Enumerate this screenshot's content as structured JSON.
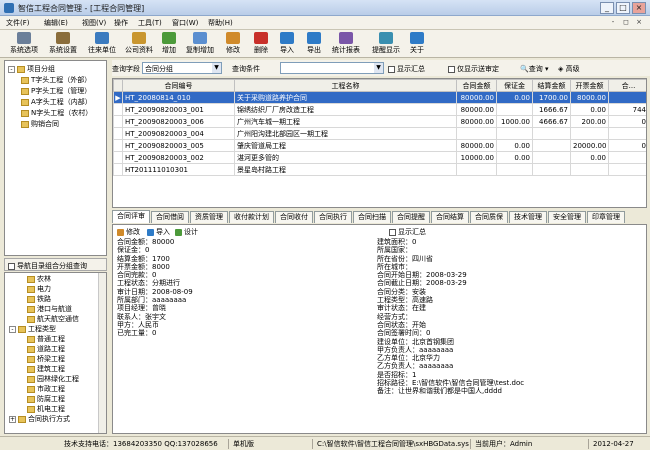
{
  "window": {
    "title": "智信工程合同管理 - [工程合同管理]",
    "minimize_glyph": "_",
    "maximize_glyph": "□",
    "close_glyph": "×",
    "mdi_minimize": "-",
    "mdi_restore": "◻",
    "mdi_close": "×"
  },
  "menu": [
    "文件(F)",
    "编辑(E)",
    "视图(V)",
    "操作",
    "工具(T)",
    "窗口(W)",
    "帮助(H)"
  ],
  "toolbar": [
    {
      "label": "系统选项",
      "icon": "gear-icon",
      "color": "#6b7f99"
    },
    {
      "label": "系统设置",
      "icon": "tools-icon",
      "color": "#8a6d3b"
    },
    {
      "label": "往来单位",
      "icon": "people-icon",
      "color": "#3b7bbf"
    },
    {
      "label": "公司资料",
      "icon": "building-icon",
      "color": "#c9962f"
    },
    {
      "label": "增加",
      "icon": "add-icon",
      "color": "#4c9a3a"
    },
    {
      "label": "复制增加",
      "icon": "copy-add-icon",
      "color": "#5b8fd0"
    },
    {
      "label": "修改",
      "icon": "edit-icon",
      "color": "#d08a2a"
    },
    {
      "label": "删除",
      "icon": "delete-icon",
      "color": "#c8302a"
    },
    {
      "label": "导入",
      "icon": "import-icon",
      "color": "#2e7bc7"
    },
    {
      "label": "导出",
      "icon": "export-icon",
      "color": "#2e7bc7"
    },
    {
      "label": "统计报表",
      "icon": "report-icon",
      "color": "#7a56a8"
    },
    {
      "label": "提醒显示",
      "icon": "reminder-icon",
      "color": "#3a8fb0"
    },
    {
      "label": "关于",
      "icon": "help-icon",
      "color": "#2e7bc7"
    }
  ],
  "tree_top": [
    {
      "label": "项目分组",
      "level": 0,
      "toggle": "-"
    },
    {
      "label": "T字头工程（外部）",
      "level": 1,
      "toggle": ""
    },
    {
      "label": "P字头工程（管理）",
      "level": 1,
      "toggle": ""
    },
    {
      "label": "A字头工程（内部）",
      "level": 1,
      "toggle": ""
    },
    {
      "label": "N字头工程（农村）",
      "level": 1,
      "toggle": ""
    },
    {
      "label": "购销合同",
      "level": 1,
      "toggle": ""
    }
  ],
  "tree_bottom_header": "导航目录组合分组查询",
  "tree_bottom": [
    {
      "label": "农林",
      "level": 2,
      "toggle": ""
    },
    {
      "label": "电力",
      "level": 2,
      "toggle": ""
    },
    {
      "label": "铁路",
      "level": 2,
      "toggle": ""
    },
    {
      "label": "港口与航道",
      "level": 2,
      "toggle": ""
    },
    {
      "label": "航天航空通信",
      "level": 2,
      "toggle": ""
    },
    {
      "label": "工程类型",
      "level": 1,
      "toggle": "-"
    },
    {
      "label": "普通工程",
      "level": 2,
      "toggle": ""
    },
    {
      "label": "道路工程",
      "level": 2,
      "toggle": ""
    },
    {
      "label": "桥梁工程",
      "level": 2,
      "toggle": ""
    },
    {
      "label": "建筑工程",
      "level": 2,
      "toggle": ""
    },
    {
      "label": "园林绿化工程",
      "level": 2,
      "toggle": ""
    },
    {
      "label": "市政工程",
      "level": 2,
      "toggle": ""
    },
    {
      "label": "防腐工程",
      "level": 2,
      "toggle": ""
    },
    {
      "label": "机电工程",
      "level": 2,
      "toggle": ""
    },
    {
      "label": "合同执行方式",
      "level": 1,
      "toggle": "+"
    }
  ],
  "filter": {
    "field_label": "查询字段",
    "field_value": "合同分组",
    "cond_label": "查询条件",
    "cond_value": "",
    "summary_label": "显示汇总",
    "approval_label": "仅显示送审定",
    "query_label": "查询",
    "advanced_label": "高级"
  },
  "grid": {
    "columns": [
      "",
      "合同编号",
      "工程名称",
      "合同金额",
      "保证金",
      "结算金额",
      "开票金额",
      "合..."
    ],
    "rows": [
      {
        "id": "HT_20080814_010",
        "name": "关于采购道路养护合同",
        "amount": "80000.00",
        "deposit": "0.00",
        "settle": "1700.00",
        "invoice": "8000.00",
        "extra": "",
        "selected": true
      },
      {
        "id": "HT_20090820003_001",
        "name": "锦绣纺织厂厂房改造工程",
        "amount": "80000.00",
        "deposit": "",
        "settle": "1666.67",
        "invoice": "0.00",
        "extra": "744",
        "selected": false
      },
      {
        "id": "HT_20090820003_006",
        "name": "广州汽车城一期工程",
        "amount": "80000.00",
        "deposit": "1000.00",
        "settle": "4666.67",
        "invoice": "200.00",
        "extra": "0",
        "selected": false
      },
      {
        "id": "HT_20090820003_004",
        "name": "广州阳沟建北部园区一期工程",
        "amount": "",
        "deposit": "",
        "settle": "",
        "invoice": "",
        "extra": "",
        "selected": false
      },
      {
        "id": "HT_20090820003_005",
        "name": "肇庆管道局工程",
        "amount": "80000.00",
        "deposit": "0.00",
        "settle": "",
        "invoice": "20000.00",
        "extra": "0",
        "selected": false
      },
      {
        "id": "HT_20090820003_002",
        "name": "湛河更多管的",
        "amount": "10000.00",
        "deposit": "0.00",
        "settle": "",
        "invoice": "0.00",
        "extra": "",
        "selected": false
      },
      {
        "id": "HT201111010301",
        "name": "景星岛村路工程",
        "amount": "",
        "deposit": "",
        "settle": "",
        "invoice": "",
        "extra": "",
        "selected": false
      }
    ]
  },
  "tabs": [
    "合同评审",
    "合同借阅",
    "资质管理",
    "收付款计划",
    "合同收付",
    "合同执行",
    "合同扫描",
    "合同提醒",
    "合同结算",
    "合同质保",
    "技术管理",
    "安全管理",
    "印章管理"
  ],
  "detail_toolbar": {
    "edit": "修改",
    "import": "导入",
    "design": "设计",
    "summary": "显示汇总"
  },
  "detail_left": [
    "合同金额：80000",
    "保证金：0",
    "结算金额：1700",
    "开票金额：8000",
    "合同完款：0",
    "工程状态：分期进行",
    "审计日期：2008-08-09",
    "所属部门：aaaaaaaa",
    "项目经理：曾晓",
    "联系人：张宇文",
    "甲方：人民币",
    "已完工量：0"
  ],
  "detail_right": [
    "",
    "建筑面积：0",
    "所属国家：",
    "所在省份：四川省",
    "所在城市：",
    "合同开始日期：2008-03-29",
    "合同截止日期：2008-03-29",
    "合同分类：安装",
    "工程类型：高速路",
    "审计状态：在建",
    "经营方式：",
    "合同状态：开始",
    "合同签署时间：0",
    "建设单位：北京首钢集团",
    "甲方负责人：aaaaaaaa",
    "乙方单位：北京华力",
    "乙方负责人：aaaaaaaa",
    "是否招标：1",
    "招标路径：E:\\智信软件\\智信合同管理\\test.doc",
    "备注：让世界和谐我们都是中国人,dddd"
  ],
  "status": {
    "support": "技术支持电话：13684203350 QQ:137028656",
    "mode": "单机版",
    "db_path": "C:\\智信软件\\智信工程合同管理\\sxHBGData.sys",
    "user": "当前用户：Admin",
    "date": "2012-04-27"
  }
}
